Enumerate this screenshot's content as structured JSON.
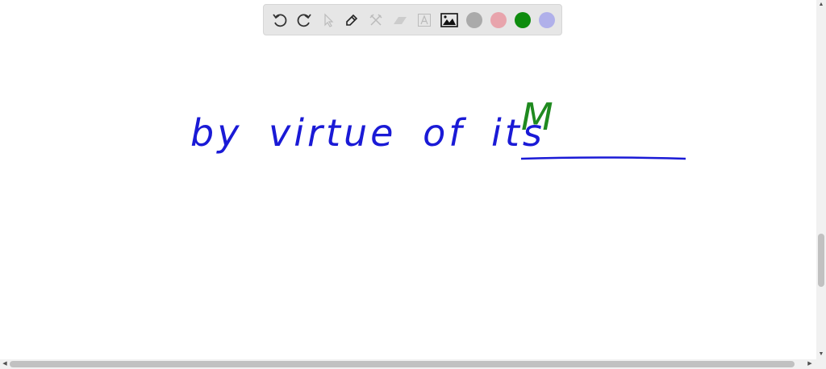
{
  "toolbar": {
    "tools": [
      "undo-icon",
      "redo-icon",
      "select-icon",
      "pen-icon",
      "tools-icon",
      "eraser-icon",
      "text-icon",
      "image-icon"
    ],
    "colors": [
      "#aaaaaa",
      "#e8a4ac",
      "#0e8c0e",
      "#b0b0ea"
    ],
    "active_color": "#0e8c0e"
  },
  "canvas": {
    "line_text": "by virtue of its",
    "answer_text": "M",
    "ink_blue": "#1a1ad6",
    "ink_green": "#1f8a1f"
  }
}
